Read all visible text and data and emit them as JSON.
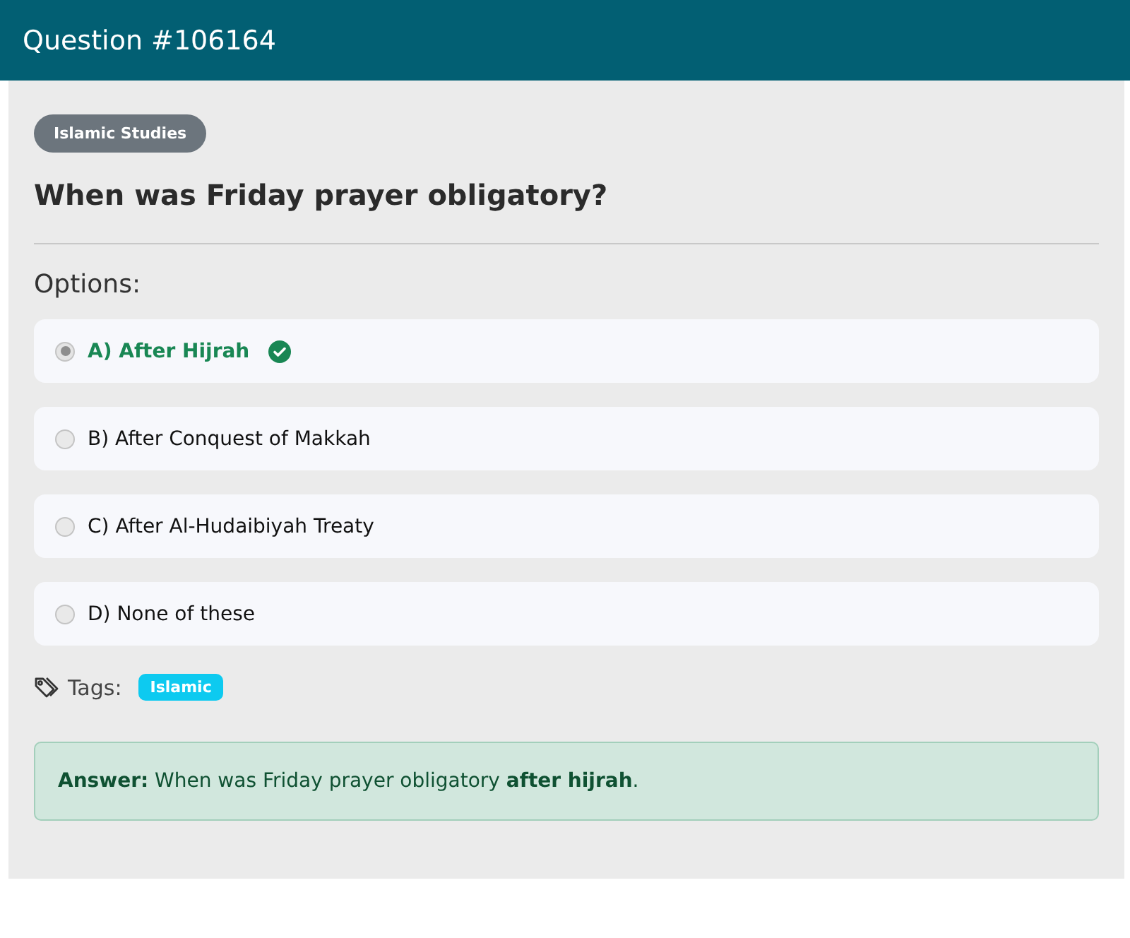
{
  "header": {
    "title": "Question #106164"
  },
  "category": "Islamic Studies",
  "question": "When was Friday prayer obligatory?",
  "options_label": "Options:",
  "options": [
    {
      "label": "A) After Hijrah",
      "selected": true,
      "correct": true
    },
    {
      "label": "B) After Conquest of Makkah",
      "selected": false,
      "correct": false
    },
    {
      "label": "C) After Al-Hudaibiyah Treaty",
      "selected": false,
      "correct": false
    },
    {
      "label": "D) None of these",
      "selected": false,
      "correct": false
    }
  ],
  "tags_label": "Tags:",
  "tags": [
    "Islamic"
  ],
  "answer": "**Answer:** When was Friday prayer obligatory **after hijrah**."
}
